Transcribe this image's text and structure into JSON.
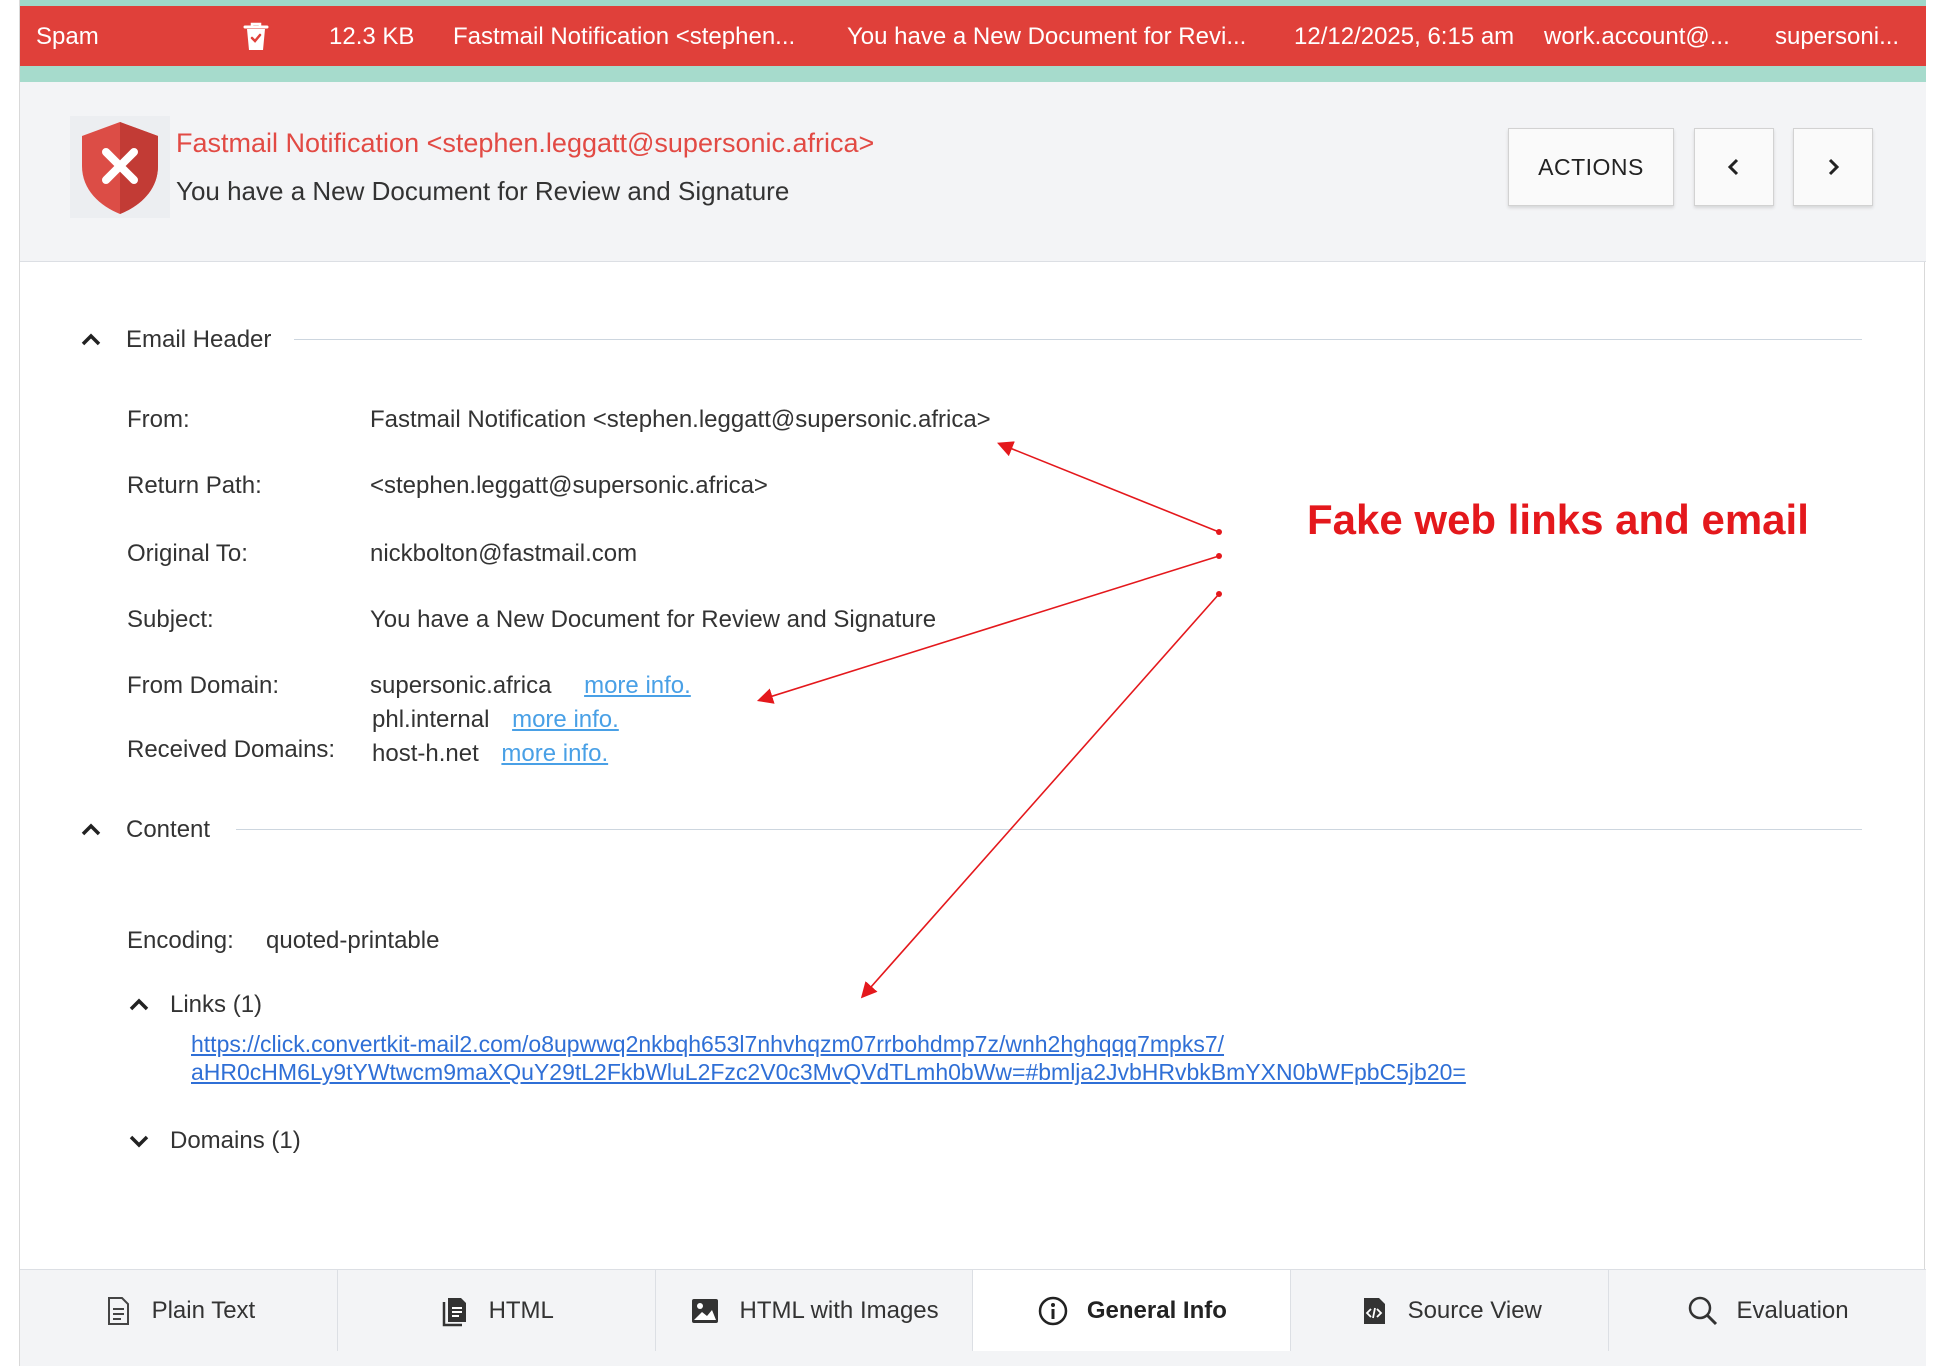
{
  "spam_row": {
    "folder": "Spam",
    "size": "12.3 KB",
    "from": "Fastmail Notification <stephen...",
    "subject": "You have a New Document for Revi...",
    "date": "12/12/2025, 6:15 am",
    "to": "work.account@...",
    "domain": "supersoni..."
  },
  "header": {
    "from": "Fastmail Notification <stephen.leggatt@supersonic.africa>",
    "subject": "You have a New Document for Review and Signature",
    "actions_label": "ACTIONS"
  },
  "email_header": {
    "title": "Email Header",
    "from_label": "From:",
    "from_value": "Fastmail Notification <stephen.leggatt@supersonic.africa>",
    "return_path_label": "Return Path:",
    "return_path_value": "<stephen.leggatt@supersonic.africa>",
    "original_to_label": "Original To:",
    "original_to_value": "nickbolton@fastmail.com",
    "subject_label": "Subject:",
    "subject_value": "You have a New Document for Review and Signature",
    "from_domain_label": "From Domain:",
    "from_domain_value": "supersonic.africa",
    "received_domains_label": "Received Domains:",
    "received_domains": [
      "phl.internal",
      "host-h.net"
    ],
    "more_info": "more info."
  },
  "content": {
    "title": "Content",
    "encoding_label": "Encoding:",
    "encoding_value": "quoted-printable",
    "links_label": "Links (1)",
    "link_line1": "https://click.convertkit-mail2.com/o8upwwq2nkbqh653l7nhvhqzm07rrbohdmp7z/wnh2hghqqq7mpks7/",
    "link_line2": "aHR0cHM6Ly9tYWtwcm9maXQuY29tL2FkbWluL2Fzc2V0c3MvQVdTLmh0bWw=#bmlja2JvbHRvbkBmYXN0bWFpbC5jb20=",
    "domains_label": "Domains (1)"
  },
  "annotation": "Fake web links and email",
  "tabs": [
    {
      "label": "Plain Text",
      "icon": "document-icon"
    },
    {
      "label": "HTML",
      "icon": "html-file-icon"
    },
    {
      "label": "HTML with Images",
      "icon": "image-icon"
    },
    {
      "label": "General Info",
      "icon": "info-icon",
      "active": true
    },
    {
      "label": "Source View",
      "icon": "source-code-icon"
    },
    {
      "label": "Evaluation",
      "icon": "search-icon"
    }
  ],
  "colors": {
    "spam_red": "#e0403a",
    "accent_teal": "#a6dbcc",
    "annotation_red": "#e4181c",
    "link_blue": "#2f6fd6"
  }
}
